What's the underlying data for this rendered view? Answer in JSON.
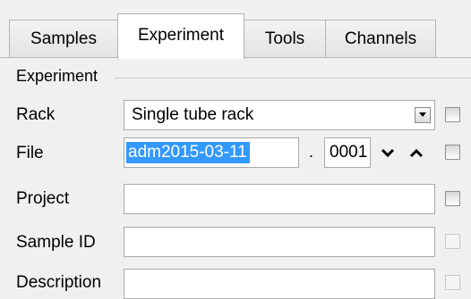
{
  "tabs": [
    {
      "label": "Samples",
      "active": false
    },
    {
      "label": "Experiment",
      "active": true
    },
    {
      "label": "Tools",
      "active": false
    },
    {
      "label": "Channels",
      "active": false
    }
  ],
  "group": {
    "title": "Experiment"
  },
  "rows": {
    "rack": {
      "label": "Rack",
      "value": "Single tube rack",
      "checked": false
    },
    "file": {
      "label": "File",
      "value": "adm2015-03-11",
      "separator": ".",
      "number": "0001",
      "checked": false
    },
    "project": {
      "label": "Project",
      "value": "",
      "checked": false
    },
    "sample_id": {
      "label": "Sample ID",
      "value": "",
      "checked": false
    },
    "description": {
      "label": "Description",
      "value": "",
      "checked": false
    }
  },
  "icons": {
    "combo": "dropdown-arrow-icon",
    "decrement": "chevron-down-icon",
    "increment": "chevron-up-icon"
  },
  "colors": {
    "selection": "#3399ff",
    "window": "#f0f0f0",
    "field": "#ffffff"
  }
}
